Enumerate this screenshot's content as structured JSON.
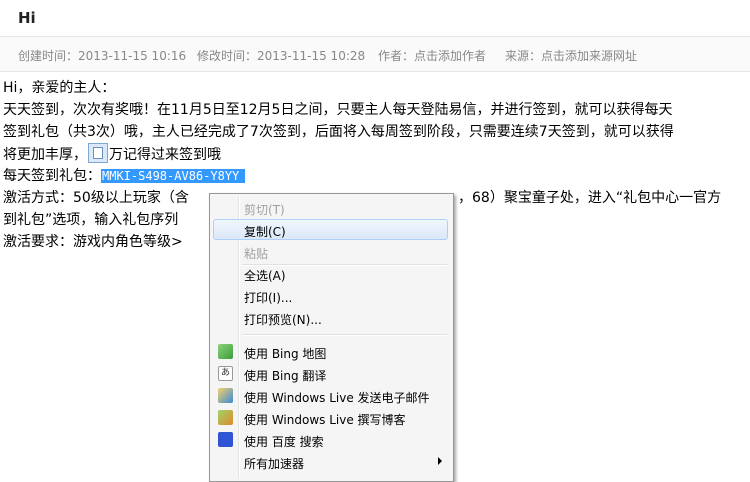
{
  "header": {
    "title": "Hi"
  },
  "meta": {
    "created": "创建时间：2013-11-15 10:16",
    "modified": "修改时间：2013-11-15 10:28",
    "author": "作者：点击添加作者",
    "source": "来源：点击添加来源网址"
  },
  "content": {
    "line1": "Hi，亲爱的主人：",
    "line2": "天天签到，次次有奖哦！在11月5日至12月5日之间，只要主人每天登陆易信，并进行签到，就可以获得每天",
    "line3": "签到礼包（共3次）哦，主人已经完成了7次签到，后面将入每周签到阶段，只需要连续7天签到，就可以获得",
    "line4_a": "将更加丰厚，",
    "line4_b": "万记得过来签到哦",
    "line5_a": "每天签到礼包：",
    "line5_code": "MMKI-S498-AV86-Y8YY",
    "line6_a": "激活方式：50级以上玩家（含",
    "line6_b": "，68）聚宝童子处，进入“礼包中心一官方",
    "line7": "到礼包”选项，输入礼包序列",
    "line8": "激活要求：游戏内角色等级>"
  },
  "context_menu": {
    "items": [
      {
        "label": "剪切(T)",
        "disabled": true
      },
      {
        "label": "复制(C)",
        "hover": true
      },
      {
        "label": "粘贴",
        "disabled": true
      },
      {
        "label": "全选(A)"
      },
      {
        "label": "打印(I)..."
      },
      {
        "label": "打印预览(N)..."
      },
      {
        "label": "使用 Bing 地图",
        "icon": "bing-maps-icon"
      },
      {
        "label": "使用 Bing 翻译",
        "icon": "bing-translate-icon"
      },
      {
        "label": "使用 Windows Live 发送电子邮件",
        "icon": "windows-live-mail-icon"
      },
      {
        "label": "使用 Windows Live 撰写博客",
        "icon": "windows-live-blog-icon"
      },
      {
        "label": "使用 百度 搜索",
        "icon": "baidu-search-icon"
      },
      {
        "label": "所有加速器",
        "icon": "submenu-arrow-icon"
      }
    ]
  },
  "colors": {
    "selection": "#3399ff",
    "menu_bg": "#f5f5f5",
    "hover_border": "#aecff7"
  }
}
